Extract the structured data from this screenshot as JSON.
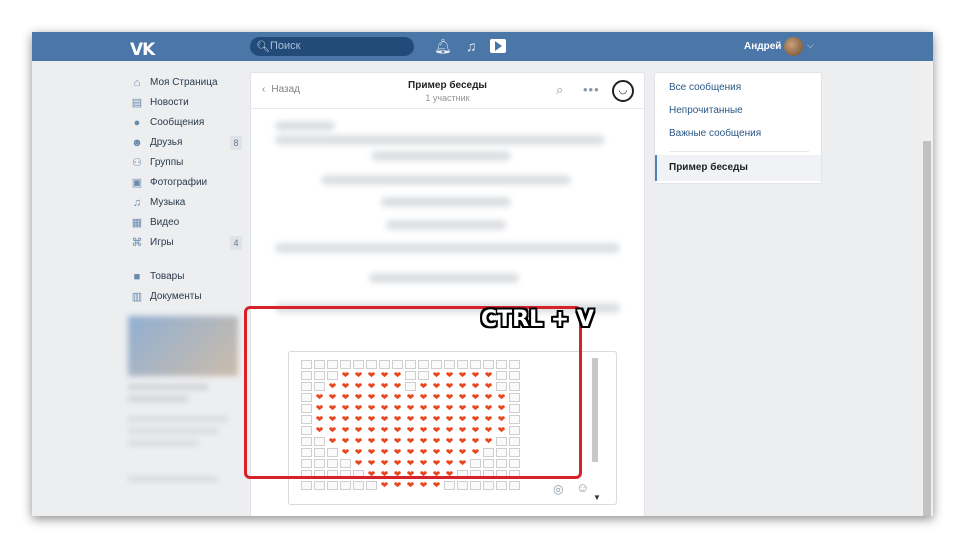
{
  "header": {
    "logo": "VK",
    "search_placeholder": "Поиск",
    "user_name": "Андрей",
    "icons": [
      "bell-icon",
      "music-note-icon",
      "video-play-icon"
    ]
  },
  "left_nav": {
    "items": [
      {
        "label": "Моя Страница",
        "icon": "home-icon",
        "badge": ""
      },
      {
        "label": "Новости",
        "icon": "news-icon",
        "badge": ""
      },
      {
        "label": "Сообщения",
        "icon": "chat-icon",
        "badge": ""
      },
      {
        "label": "Друзья",
        "icon": "friends-icon",
        "badge": "8"
      },
      {
        "label": "Группы",
        "icon": "groups-icon",
        "badge": ""
      },
      {
        "label": "Фотографии",
        "icon": "camera-icon",
        "badge": ""
      },
      {
        "label": "Музыка",
        "icon": "music-icon",
        "badge": ""
      },
      {
        "label": "Видео",
        "icon": "film-icon",
        "badge": ""
      },
      {
        "label": "Игры",
        "icon": "gamepad-icon",
        "badge": "4"
      }
    ],
    "items2": [
      {
        "label": "Товары",
        "icon": "bag-icon"
      },
      {
        "label": "Документы",
        "icon": "document-icon"
      }
    ]
  },
  "chat": {
    "back_label": "Назад",
    "title": "Пример беседы",
    "subtitle": "1 участник"
  },
  "overlay": {
    "label": "CTRL + V"
  },
  "right_nav": {
    "items": [
      "Все сообщения",
      "Непрочитанные",
      "Важные сообщения"
    ],
    "active": "Пример беседы"
  },
  "colors": {
    "brand": "#4a76a8",
    "highlight": "#d8222a",
    "heart": "#e8461c"
  }
}
